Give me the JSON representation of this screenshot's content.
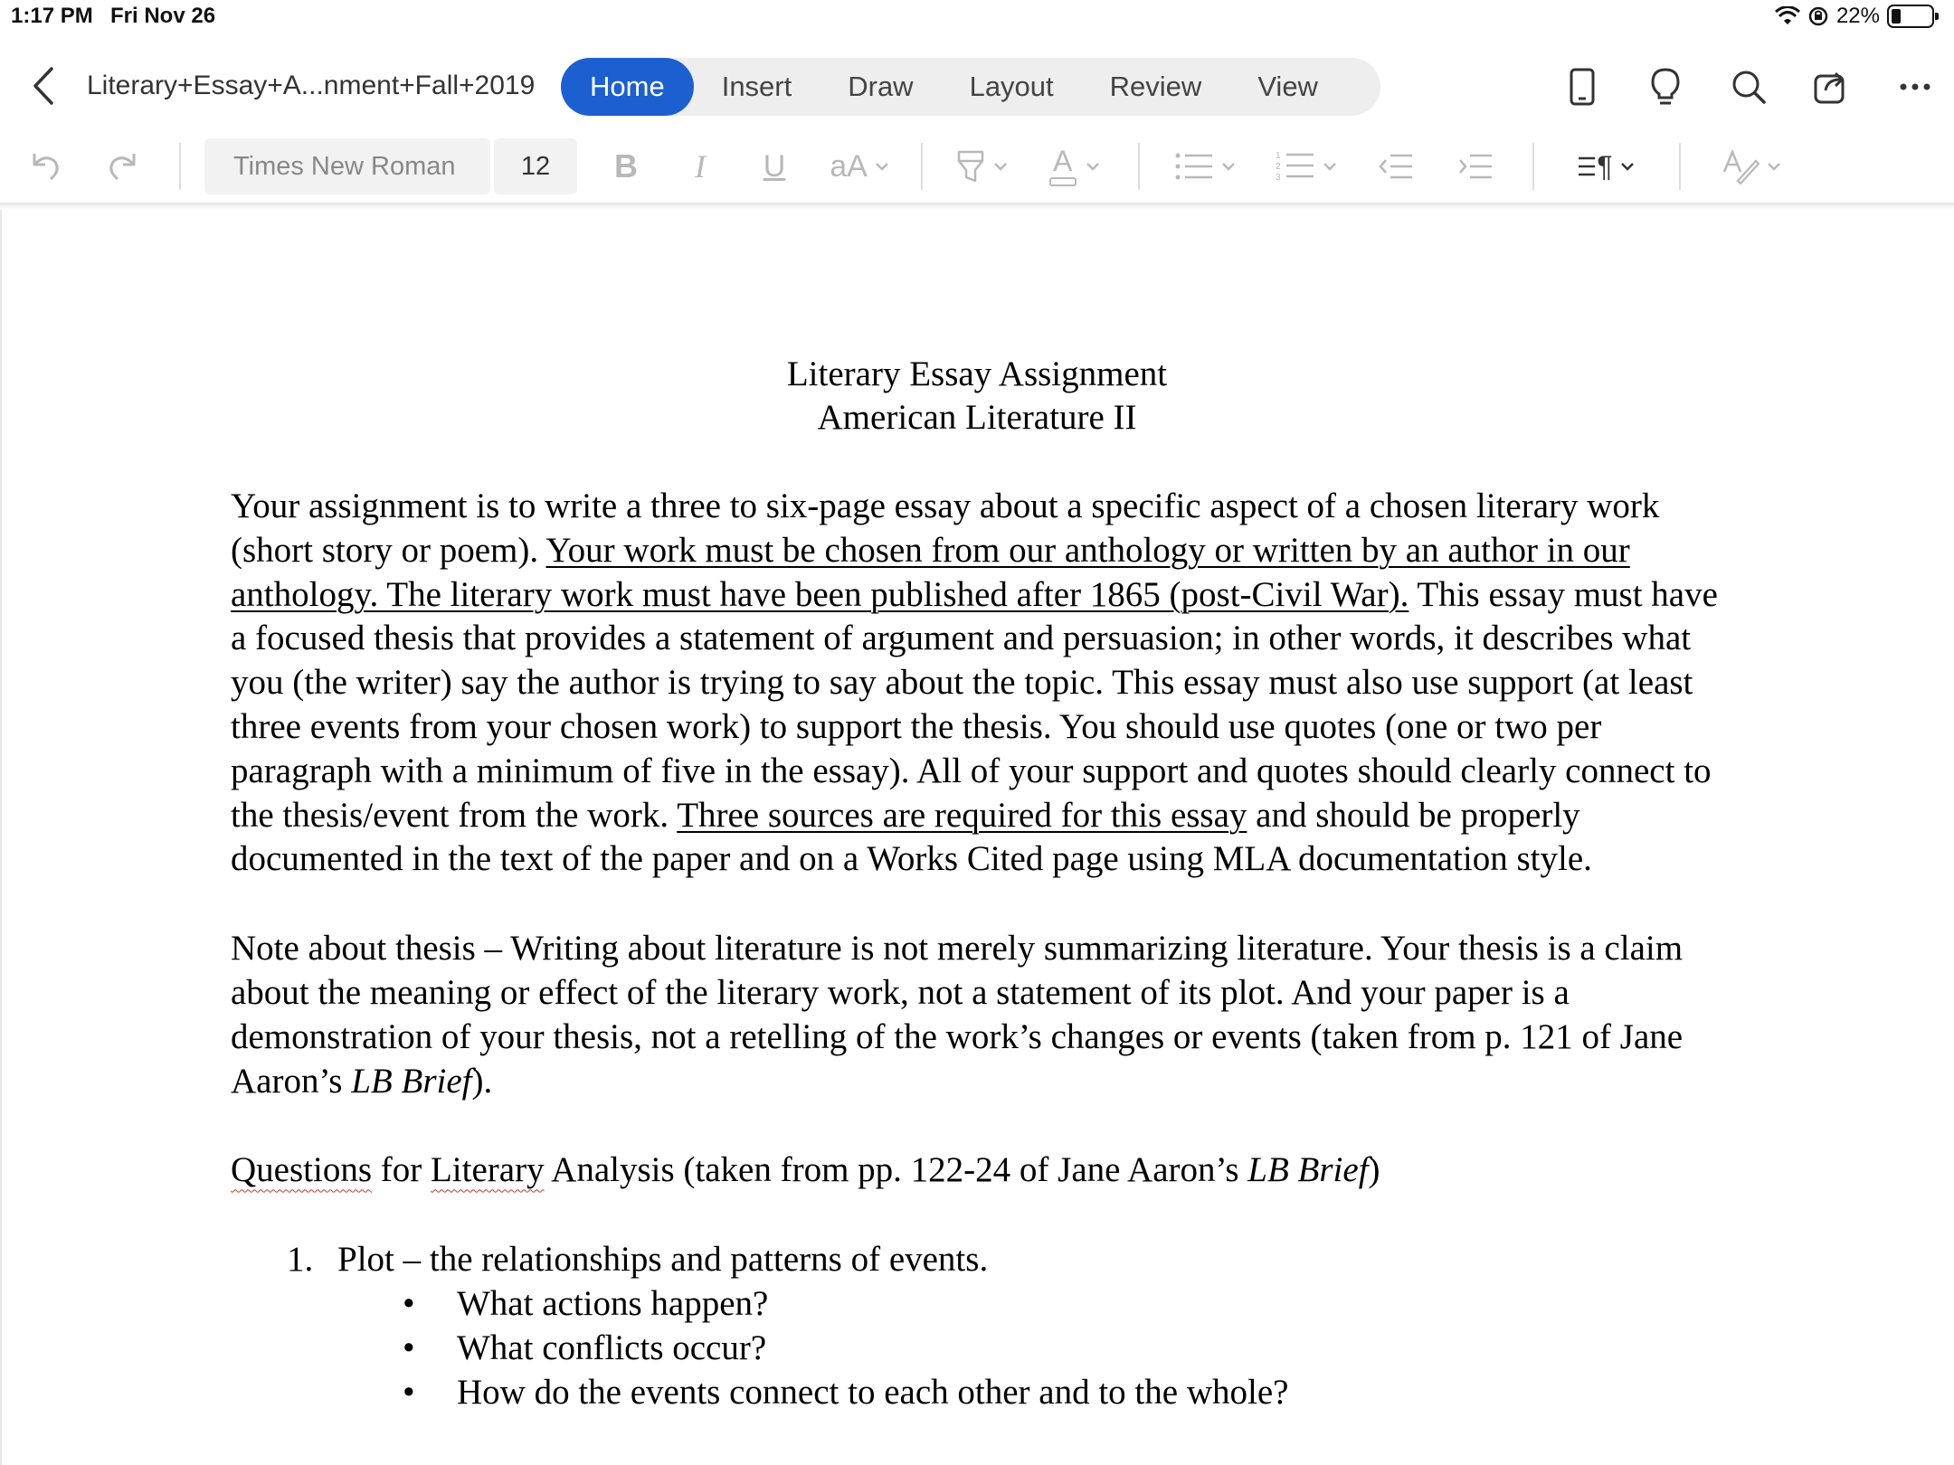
{
  "status": {
    "time": "1:17 PM",
    "date": "Fri Nov 26",
    "battery": "22%"
  },
  "titlebar": {
    "doc_title": "Literary+Essay+A...nment+Fall+2019",
    "tabs": [
      {
        "label": "Home",
        "active": true
      },
      {
        "label": "Insert"
      },
      {
        "label": "Draw"
      },
      {
        "label": "Layout"
      },
      {
        "label": "Review"
      },
      {
        "label": "View"
      }
    ],
    "icons": [
      "phone-view-icon",
      "lightbulb-icon",
      "search-icon",
      "share-icon",
      "more-icon"
    ]
  },
  "ribbon": {
    "font_name": "Times New Roman",
    "font_size": "12",
    "bold": "B",
    "italic": "I",
    "underline": "U",
    "font_size_change": "aA",
    "font_color_letter": "A",
    "text_direction_mark": "¶"
  },
  "document": {
    "heading_line1": "Literary Essay Assignment",
    "heading_line2": "American Literature II",
    "p1_a": "Your assignment is to write a three to six-page essay about a specific aspect of a chosen literary work (short story or poem). ",
    "p1_u1": "Your work must be chosen from our anthology or written by an author in our anthology. The literary work must have been published after 1865 (post-Civil War).",
    "p1_b": " This essay must have a focused thesis that provides a statement of argument and persuasion; in other words, it describes what you (the writer) say the author is trying to say about the topic. This essay must also use support (at least three events from your chosen work) to support the thesis.  You should use quotes (one or two per paragraph with a minimum of five in the essay). All of your support and quotes should clearly connect to the thesis/event from the work.  ",
    "p1_u2": "Three sources are required for this essay",
    "p1_c": " and should be properly documented in the text of the paper and on a Works Cited page using MLA documentation style.",
    "p2_a": "Note about thesis – Writing about literature is not merely summarizing literature.  Your thesis is a claim about the meaning or effect of the literary work, not a statement of its plot.  And your paper is a demonstration of your thesis, not a retelling of the work’s changes or events (taken from p. 121 of Jane Aaron’s ",
    "p2_i": "LB Brief",
    "p2_b": ").",
    "q_u1": "Questions",
    "q_mid1": " for ",
    "q_u2": "Literary",
    "q_mid2": " Analysis (taken from pp. 122-24 of Jane Aaron’s ",
    "q_i": "LB Brief",
    "q_end": ")",
    "list": [
      {
        "num": "1.",
        "text": "Plot – the relationships and patterns of events.",
        "bullets": [
          "What actions happen?",
          "What conflicts occur?",
          "How do the events connect to each other and to the whole?"
        ]
      }
    ],
    "bullet_char": "•"
  },
  "colors": {
    "accent": "#1c5fd1",
    "tab_bar_bg": "#eeeeee",
    "disabled_icon": "#b0b0b0",
    "text": "#000000"
  }
}
